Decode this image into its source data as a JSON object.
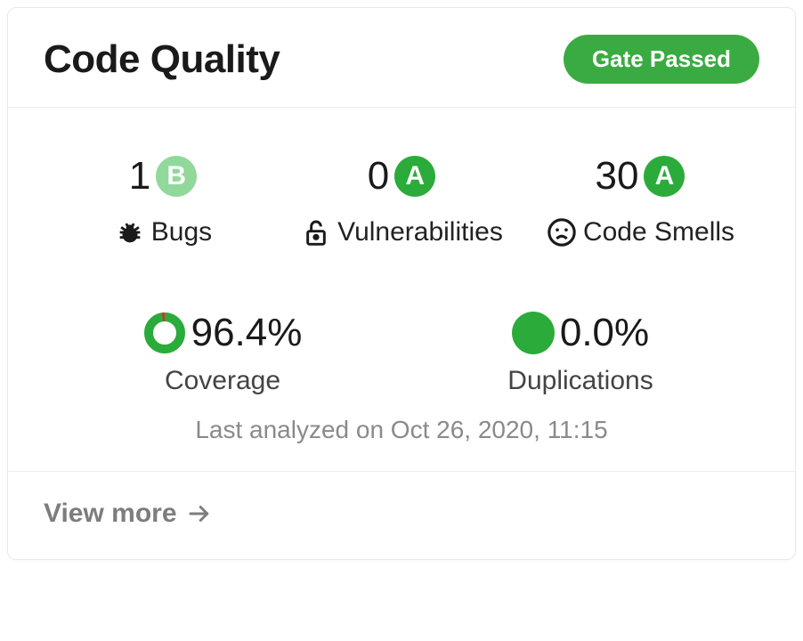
{
  "header": {
    "title": "Code Quality",
    "gate_label": "Gate Passed",
    "gate_color": "#3aab42"
  },
  "metrics": {
    "bugs": {
      "value": "1",
      "grade": "B",
      "grade_color": "#91d89b",
      "label": "Bugs",
      "icon": "bug-icon"
    },
    "vulnerabilities": {
      "value": "0",
      "grade": "A",
      "grade_color": "#2aab3a",
      "label": "Vulnerabilities",
      "icon": "lock-open-icon"
    },
    "code_smells": {
      "value": "30",
      "grade": "A",
      "grade_color": "#2aab3a",
      "label": "Code Smells",
      "icon": "frown-icon"
    },
    "coverage": {
      "value": "96.4%",
      "label": "Coverage",
      "percent": 96.4,
      "uncovered_color": "#d63031",
      "covered_color": "#2aab3a"
    },
    "duplications": {
      "value": "0.0%",
      "label": "Duplications",
      "percent": 0.0,
      "color": "#2aab3a"
    }
  },
  "footer": {
    "last_analyzed": "Last analyzed on Oct 26, 2020, 11:15",
    "view_more": "View more"
  }
}
